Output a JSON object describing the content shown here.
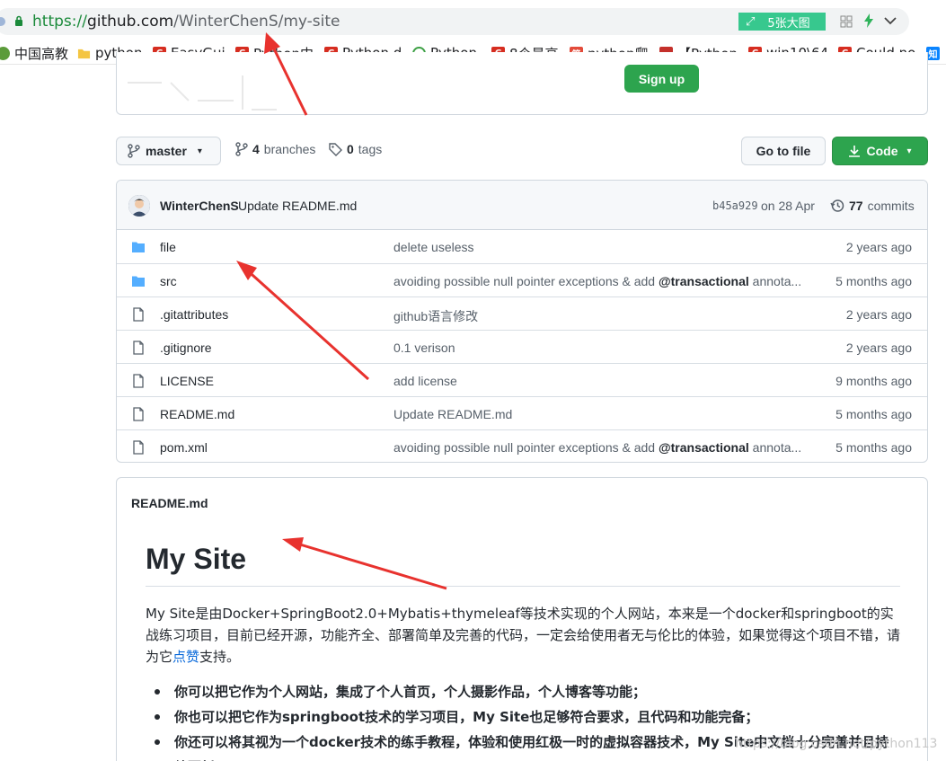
{
  "browser": {
    "url_scheme": "https://",
    "url_host": "github.com",
    "url_path": "/WinterChenS/my-site",
    "image_badge": "5张大图"
  },
  "bookmarks": [
    {
      "label": "中国高教",
      "icon": "globe-icon"
    },
    {
      "label": "python",
      "icon": "folder-icon"
    },
    {
      "label": "EasyGui",
      "icon": "csdn-icon"
    },
    {
      "label": "Python中",
      "icon": "csdn-icon"
    },
    {
      "label": "Python d",
      "icon": "csdn-icon"
    },
    {
      "label": "Python",
      "icon": "kz-icon"
    },
    {
      "label": "8个最高",
      "icon": "csdn-icon"
    },
    {
      "label": "python爬",
      "icon": "jianshu-icon"
    },
    {
      "label": "【Python",
      "icon": "red-icon"
    },
    {
      "label": "win10\\64",
      "icon": "csdn-icon"
    },
    {
      "label": "Could no",
      "icon": "csdn-icon"
    },
    {
      "label": "知",
      "icon": "zhihu-icon"
    }
  ],
  "header": {
    "signup_label": "Sign up"
  },
  "repo_nav": {
    "branch_label": "master",
    "branches_count": "4",
    "branches_label": "branches",
    "tags_count": "0",
    "tags_label": "tags",
    "go_to_file_label": "Go to file",
    "code_label": "Code"
  },
  "latest_commit": {
    "author": "WinterChenS",
    "message": "Update README.md",
    "sha": "b45a929",
    "date": "on 28 Apr",
    "commits_count": "77",
    "commits_label": "commits"
  },
  "files": [
    {
      "type": "folder",
      "name": "file",
      "message": "delete useless",
      "message_bold": "",
      "message_tail": "",
      "age": "2 years ago"
    },
    {
      "type": "folder",
      "name": "src",
      "message": "avoiding possible null pointer exceptions & add ",
      "message_bold": "@transactional",
      "message_tail": " annota...",
      "age": "5 months ago"
    },
    {
      "type": "file",
      "name": ".gitattributes",
      "message": "github语言修改",
      "message_bold": "",
      "message_tail": "",
      "age": "2 years ago"
    },
    {
      "type": "file",
      "name": ".gitignore",
      "message": "0.1 verison",
      "message_bold": "",
      "message_tail": "",
      "age": "2 years ago"
    },
    {
      "type": "file",
      "name": "LICENSE",
      "message": "add license",
      "message_bold": "",
      "message_tail": "",
      "age": "9 months ago"
    },
    {
      "type": "file",
      "name": "README.md",
      "message": "Update README.md",
      "message_bold": "",
      "message_tail": "",
      "age": "5 months ago"
    },
    {
      "type": "file",
      "name": "pom.xml",
      "message": "avoiding possible null pointer exceptions & add ",
      "message_bold": "@transactional",
      "message_tail": " annota...",
      "age": "5 months ago"
    }
  ],
  "readme": {
    "filename": "README.md",
    "title": "My Site",
    "intro": "My Site是由Docker+SpringBoot2.0+Mybatis+thymeleaf等技术实现的个人网站，本来是一个docker和springboot的实战练习项目，目前已经开源，功能齐全、部署简单及完善的代码，一定会给使用者无与伦比的体验，如果觉得这个项目不错，请为它",
    "intro_link": "点赞",
    "intro_tail": "支持。",
    "bullets": [
      "你可以把它作为个人网站，集成了个人首页，个人摄影作品，个人博客等功能；",
      "你也可以把它作为springboot技术的学习项目，My Site也足够符合要求，且代码和功能完备；",
      "你还可以将其视为一个docker技术的练手教程，体验和使用红极一时的虚拟容器技术，My Site中文档十分完善并且持续更新。"
    ]
  },
  "watermark": "https://blog.csdn.net/python113",
  "colors": {
    "primary_green": "#2da44e",
    "link_blue": "#0969da",
    "folder_blue": "#54aeff",
    "annotation_red": "#e8322e"
  }
}
